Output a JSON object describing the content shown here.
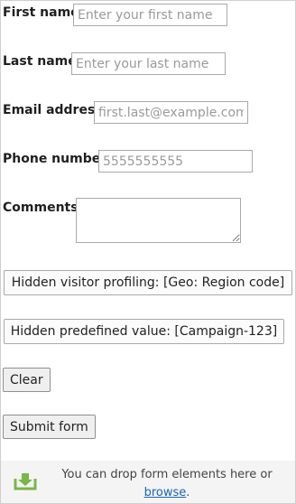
{
  "form": {
    "first_name": {
      "label": "First name",
      "placeholder": "Enter your first name"
    },
    "last_name": {
      "label": "Last name",
      "placeholder": "Enter your last name"
    },
    "email": {
      "label": "Email address",
      "placeholder": "first.last@example.com"
    },
    "phone": {
      "label": "Phone number",
      "placeholder": "5555555555"
    },
    "comments": {
      "label": "Comments",
      "placeholder": ""
    },
    "hidden_fields": [
      {
        "text": "Hidden visitor profiling: [Geo: Region code]"
      },
      {
        "text": "Hidden predefined value: [Campaign-123]"
      }
    ],
    "clear_label": "Clear",
    "submit_label": "Submit form"
  },
  "dropzone": {
    "text": "You can drop form elements here or",
    "browse_label": "browse",
    "suffix": ".",
    "icon": "drop-arrow-down-icon",
    "icon_color": "#7ab648"
  }
}
